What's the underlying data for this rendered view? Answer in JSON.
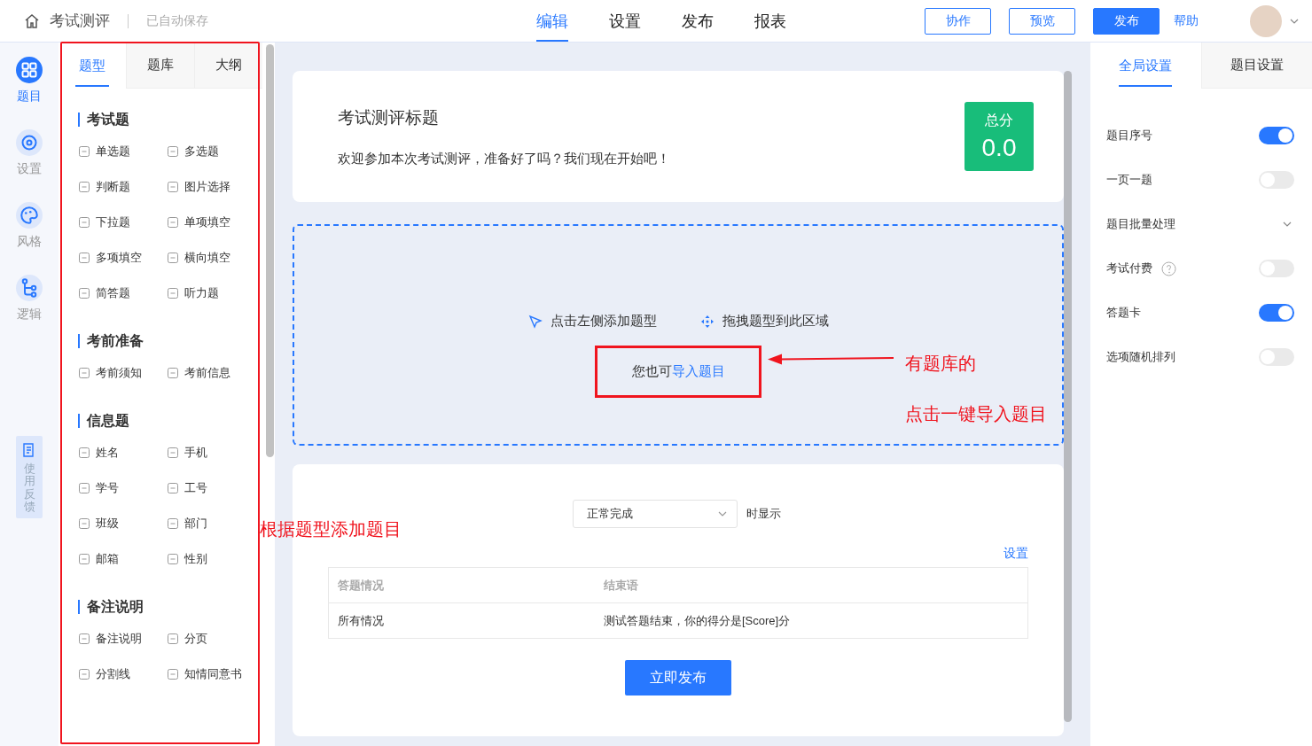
{
  "topbar": {
    "title": "考试测评",
    "autosave": "已自动保存",
    "nav": [
      {
        "label": "编辑",
        "selected": true
      },
      {
        "label": "设置",
        "selected": false
      },
      {
        "label": "发布",
        "selected": false
      },
      {
        "label": "报表",
        "selected": false
      }
    ],
    "buttons": [
      {
        "label": "协作",
        "kind": "outline"
      },
      {
        "label": "预览",
        "kind": "outline"
      },
      {
        "label": "发布",
        "kind": "primary"
      }
    ],
    "help": "帮助"
  },
  "rail": {
    "items": [
      {
        "label": "题目",
        "selected": true
      },
      {
        "label": "设置",
        "selected": false
      },
      {
        "label": "风格",
        "selected": false
      },
      {
        "label": "逻辑",
        "selected": false
      }
    ],
    "feedback": "使用反馈"
  },
  "panel": {
    "tabs": [
      {
        "label": "题型",
        "selected": true
      },
      {
        "label": "题库",
        "selected": false
      },
      {
        "label": "大纲",
        "selected": false
      }
    ],
    "groups": [
      {
        "title": "考试题",
        "items": [
          "单选题",
          "多选题",
          "判断题",
          "图片选择",
          "下拉题",
          "单项填空",
          "多项填空",
          "横向填空",
          "简答题",
          "听力题"
        ]
      },
      {
        "title": "考前准备",
        "items": [
          "考前须知",
          "考前信息"
        ]
      },
      {
        "title": "信息题",
        "items": [
          "姓名",
          "手机",
          "学号",
          "工号",
          "班级",
          "部门",
          "邮箱",
          "性别"
        ]
      },
      {
        "title": "备注说明",
        "items": [
          "备注说明",
          "分页",
          "分割线",
          "知情同意书"
        ]
      }
    ]
  },
  "header_card": {
    "title": "考试测评标题",
    "welcome": "欢迎参加本次考试测评，准备好了吗？我们现在开始吧！",
    "score_label": "总分",
    "score": "0.0"
  },
  "drop_zone": {
    "hints": [
      "点击左侧添加题型",
      "拖拽题型到此区域"
    ],
    "import_prefix": "您也可",
    "import_link": "导入题目"
  },
  "end_card": {
    "select": "正常完成",
    "select_suffix": "时显示",
    "settings_link": "设置",
    "table": {
      "columns": [
        "答题情况",
        "结束语"
      ],
      "rows": [
        [
          "所有情况",
          "测试答题结束，你的得分是[Score]分"
        ]
      ]
    },
    "publish": "立即发布"
  },
  "annotations": [
    "有题库的",
    "点击一键导入题目",
    "根据题型添加题目"
  ],
  "settings_panel": {
    "tabs": [
      {
        "label": "全局设置",
        "selected": true
      },
      {
        "label": "题目设置",
        "selected": false
      }
    ],
    "rows": [
      {
        "label": "题目序号",
        "kind": "toggle",
        "on": true
      },
      {
        "label": "一页一题",
        "kind": "toggle",
        "on": false
      },
      {
        "label": "题目批量处理",
        "kind": "dropdown"
      },
      {
        "label": "考试付费",
        "kind": "toggle",
        "on": false,
        "help": true
      },
      {
        "label": "答题卡",
        "kind": "toggle",
        "on": true
      },
      {
        "label": "选项随机排列",
        "kind": "toggle",
        "on": false
      }
    ]
  }
}
